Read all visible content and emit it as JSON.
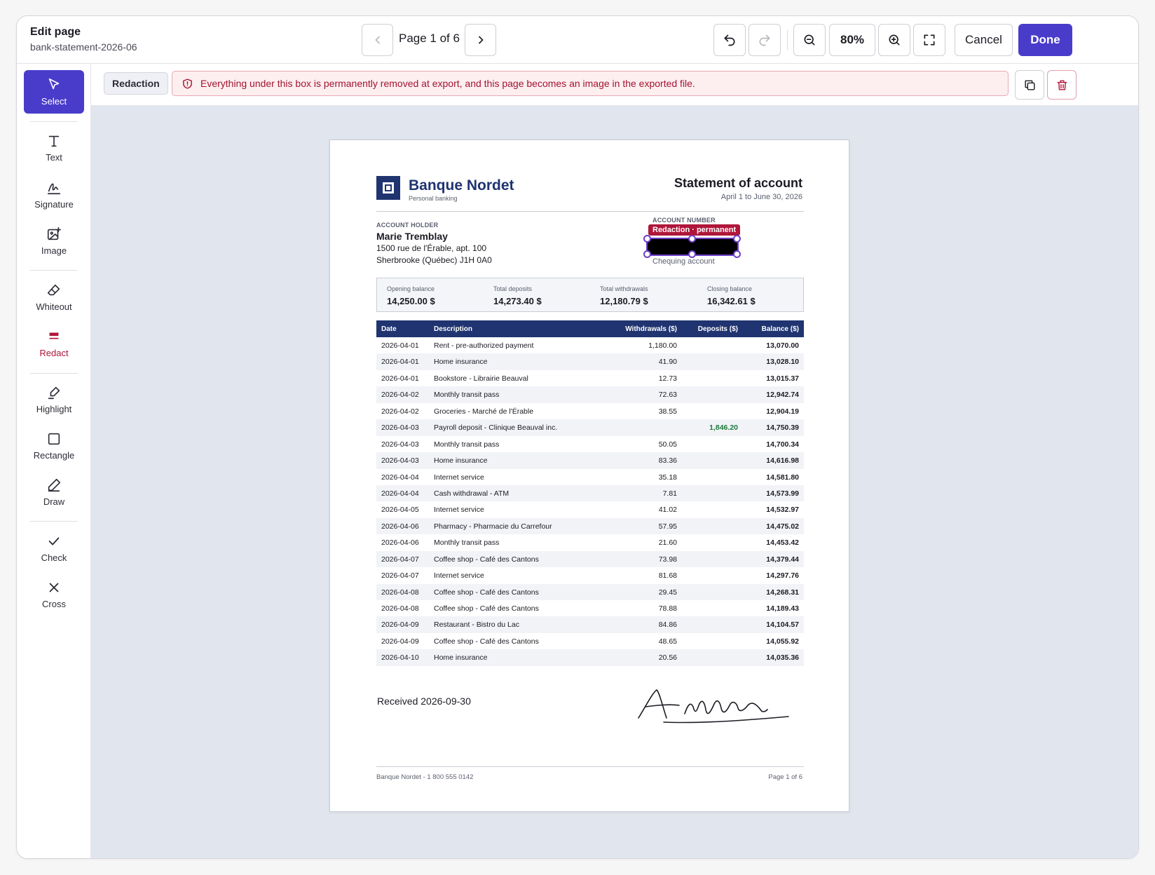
{
  "header": {
    "title": "Edit page",
    "filename": "bank-statement-2026-06",
    "page_indicator": "Page 1 of 6",
    "zoom": "80%",
    "cancel_label": "Cancel",
    "done_label": "Done"
  },
  "tools": [
    {
      "label": "Select",
      "icon": "cursor-icon",
      "active": true
    },
    {
      "label": "Text",
      "icon": "text-icon"
    },
    {
      "label": "Signature",
      "icon": "signature-icon"
    },
    {
      "label": "Image",
      "icon": "image-icon"
    },
    {
      "label": "Whiteout",
      "icon": "eraser-icon"
    },
    {
      "label": "Redact",
      "icon": "redact-icon"
    },
    {
      "label": "Highlight",
      "icon": "highlighter-icon"
    },
    {
      "label": "Rectangle",
      "icon": "rectangle-icon"
    },
    {
      "label": "Draw",
      "icon": "pen-icon"
    },
    {
      "label": "Check",
      "icon": "check-icon"
    },
    {
      "label": "Cross",
      "icon": "cross-icon"
    }
  ],
  "context": {
    "chip": "Redaction",
    "warning": "Everything under this box is permanently removed at export, and this page becomes an image in the exported file."
  },
  "document": {
    "bank_name": "Banque Nordet",
    "bank_subtitle": "Personal banking",
    "statement_title": "Statement of account",
    "period": "April 1 to June 30, 2026",
    "holder_label": "ACCOUNT HOLDER",
    "holder_name": "Marie Tremblay",
    "address_line1": "1500 rue de l'Érable, apt. 100",
    "address_line2": "Sherbrooke (Québec)  J1H 0A0",
    "account_number_label": "ACCOUNT NUMBER",
    "redaction_tag": "Redaction · permanent",
    "account_type": "Chequing account",
    "summary": [
      {
        "label": "Opening balance",
        "value": "14,250.00 $"
      },
      {
        "label": "Total deposits",
        "value": "14,273.40 $"
      },
      {
        "label": "Total withdrawals",
        "value": "12,180.79 $"
      },
      {
        "label": "Closing balance",
        "value": "16,342.61 $"
      }
    ],
    "columns": [
      "Date",
      "Description",
      "Withdrawals ($)",
      "Deposits ($)",
      "Balance ($)"
    ],
    "rows": [
      [
        "2026-04-01",
        "Rent - pre-authorized payment",
        "1,180.00",
        "",
        "13,070.00"
      ],
      [
        "2026-04-01",
        "Home insurance",
        "41.90",
        "",
        "13,028.10"
      ],
      [
        "2026-04-01",
        "Bookstore - Librairie Beauval",
        "12.73",
        "",
        "13,015.37"
      ],
      [
        "2026-04-02",
        "Monthly transit pass",
        "72.63",
        "",
        "12,942.74"
      ],
      [
        "2026-04-02",
        "Groceries - Marché de l'Érable",
        "38.55",
        "",
        "12,904.19"
      ],
      [
        "2026-04-03",
        "Payroll deposit - Clinique Beauval inc.",
        "",
        "1,846.20",
        "14,750.39"
      ],
      [
        "2026-04-03",
        "Monthly transit pass",
        "50.05",
        "",
        "14,700.34"
      ],
      [
        "2026-04-03",
        "Home insurance",
        "83.36",
        "",
        "14,616.98"
      ],
      [
        "2026-04-04",
        "Internet service",
        "35.18",
        "",
        "14,581.80"
      ],
      [
        "2026-04-04",
        "Cash withdrawal - ATM",
        "7.81",
        "",
        "14,573.99"
      ],
      [
        "2026-04-05",
        "Internet service",
        "41.02",
        "",
        "14,532.97"
      ],
      [
        "2026-04-06",
        "Pharmacy - Pharmacie du Carrefour",
        "57.95",
        "",
        "14,475.02"
      ],
      [
        "2026-04-06",
        "Monthly transit pass",
        "21.60",
        "",
        "14,453.42"
      ],
      [
        "2026-04-07",
        "Coffee shop - Café des Cantons",
        "73.98",
        "",
        "14,379.44"
      ],
      [
        "2026-04-07",
        "Internet service",
        "81.68",
        "",
        "14,297.76"
      ],
      [
        "2026-04-08",
        "Coffee shop - Café des Cantons",
        "29.45",
        "",
        "14,268.31"
      ],
      [
        "2026-04-08",
        "Coffee shop - Café des Cantons",
        "78.88",
        "",
        "14,189.43"
      ],
      [
        "2026-04-09",
        "Restaurant - Bistro du Lac",
        "84.86",
        "",
        "14,104.57"
      ],
      [
        "2026-04-09",
        "Coffee shop - Café des Cantons",
        "48.65",
        "",
        "14,055.92"
      ],
      [
        "2026-04-10",
        "Home insurance",
        "20.56",
        "",
        "14,035.36"
      ]
    ],
    "received_note": "Received 2026-09-30",
    "footer_left": "Banque Nordet - 1 800 555 0142",
    "footer_right": "Page 1 of 6"
  },
  "colors": {
    "accent": "#4a3ccb",
    "redact": "#b0163a",
    "bank_navy": "#1f3470",
    "deposit_green": "#1f7a3e"
  }
}
